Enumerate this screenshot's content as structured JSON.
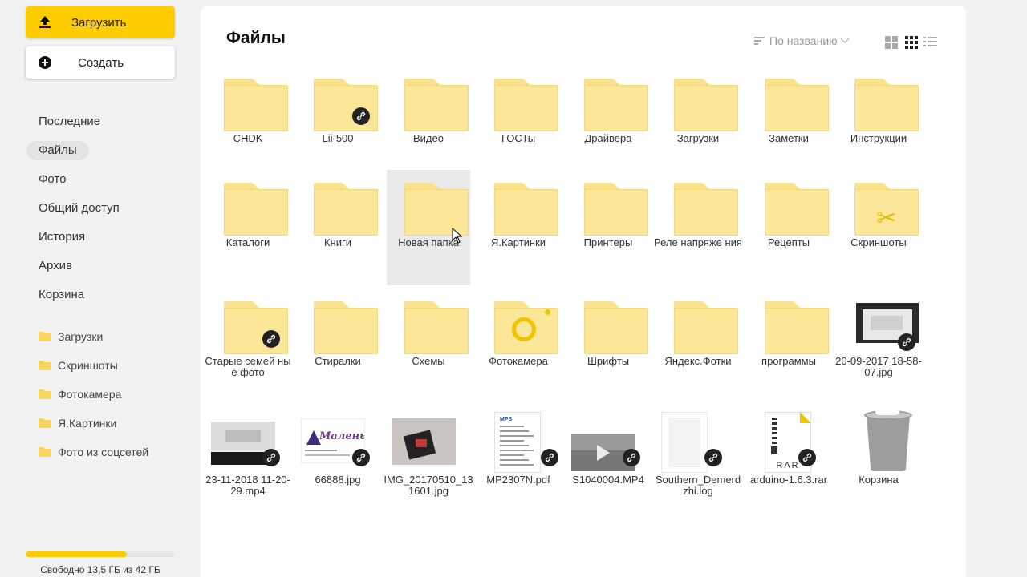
{
  "sidebar": {
    "upload_label": "Загрузить",
    "create_label": "Создать",
    "nav": [
      {
        "label": "Последние",
        "active": false
      },
      {
        "label": "Файлы",
        "active": true
      },
      {
        "label": "Фото",
        "active": false
      },
      {
        "label": "Общий доступ",
        "active": false
      },
      {
        "label": "История",
        "active": false
      },
      {
        "label": "Архив",
        "active": false
      },
      {
        "label": "Корзина",
        "active": false
      }
    ],
    "folders": [
      "Загрузки",
      "Скриншоты",
      "Фотокамера",
      "Я.Картинки",
      "Фото из соцсетей"
    ],
    "storage": {
      "text": "Свободно 13,5 ГБ из 42 ГБ",
      "used_fraction": 0.68
    }
  },
  "main": {
    "title": "Файлы",
    "sort_label": "По названию",
    "items": [
      {
        "name": "CHDK",
        "kind": "folder",
        "shared": false
      },
      {
        "name": "Lii-500",
        "kind": "folder",
        "shared": true
      },
      {
        "name": "Видео",
        "kind": "folder",
        "shared": false
      },
      {
        "name": "ГОСТы",
        "kind": "folder",
        "shared": false
      },
      {
        "name": "Драйвера",
        "kind": "folder",
        "shared": false
      },
      {
        "name": "Загрузки",
        "kind": "folder",
        "shared": false
      },
      {
        "name": "Заметки",
        "kind": "folder",
        "shared": false
      },
      {
        "name": "Инструкции",
        "kind": "folder",
        "shared": false
      },
      {
        "name": "Каталоги",
        "kind": "folder",
        "shared": false
      },
      {
        "name": "Книги",
        "kind": "folder",
        "shared": false
      },
      {
        "name": "Новая папка",
        "kind": "folder",
        "shared": false,
        "hover": true
      },
      {
        "name": "Я.Картинки",
        "kind": "folder",
        "shared": false
      },
      {
        "name": "Принтеры",
        "kind": "folder",
        "shared": false
      },
      {
        "name": "Реле напряже ния",
        "kind": "folder",
        "shared": false
      },
      {
        "name": "Рецепты",
        "kind": "folder",
        "shared": false
      },
      {
        "name": "Скриншоты",
        "kind": "folder-scissors",
        "shared": false
      },
      {
        "name": "Старые семей ные фото",
        "kind": "folder",
        "shared": true
      },
      {
        "name": "Стиралки",
        "kind": "folder",
        "shared": false
      },
      {
        "name": "Схемы",
        "kind": "folder",
        "shared": false
      },
      {
        "name": "Фотокамера",
        "kind": "folder-camera",
        "shared": false
      },
      {
        "name": "Шрифты",
        "kind": "folder",
        "shared": false
      },
      {
        "name": "Яндекс.Фотки",
        "kind": "folder",
        "shared": false
      },
      {
        "name": "программы",
        "kind": "folder",
        "shared": false
      },
      {
        "name": "20-09-2017 18-58-07.jpg",
        "kind": "image-screen",
        "shared": true
      },
      {
        "name": "23-11-2018 11-20-29.mp4",
        "kind": "video-screen",
        "shared": true
      },
      {
        "name": "66888.jpg",
        "kind": "image-logo",
        "shared": true,
        "thumb_text": "Маленьк"
      },
      {
        "name": "IMG_20170510_131601.jpg",
        "kind": "image-photo",
        "shared": false
      },
      {
        "name": "MP2307N.pdf",
        "kind": "pdf",
        "shared": true,
        "thumb_text": "MPS"
      },
      {
        "name": "S1040004.MP4",
        "kind": "video",
        "shared": true
      },
      {
        "name": "Southern_Demerdzhi.log",
        "kind": "log",
        "shared": true
      },
      {
        "name": "arduino-1.6.3.rar",
        "kind": "rar",
        "shared": true,
        "thumb_text": "RAR"
      },
      {
        "name": "Корзина",
        "kind": "trash",
        "shared": false
      }
    ]
  },
  "icons": {
    "upload": "upload-icon",
    "create": "plus-circle-icon",
    "sort": "sort-lines-icon",
    "link": "link-icon",
    "views": [
      "grid-large-icon",
      "grid-small-icon",
      "list-icon"
    ]
  },
  "colors": {
    "accent": "#ffcc00",
    "folder": "#fce798",
    "link_badge": "#222222"
  }
}
